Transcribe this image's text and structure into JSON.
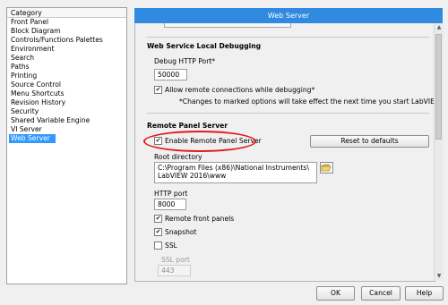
{
  "sidebar": {
    "header": "Category",
    "items": [
      {
        "label": "Front Panel",
        "selected": false
      },
      {
        "label": "Block Diagram",
        "selected": false
      },
      {
        "label": "Controls/Functions Palettes",
        "selected": false
      },
      {
        "label": "Environment",
        "selected": false
      },
      {
        "label": "Search",
        "selected": false
      },
      {
        "label": "Paths",
        "selected": false
      },
      {
        "label": "Printing",
        "selected": false
      },
      {
        "label": "Source Control",
        "selected": false
      },
      {
        "label": "Menu Shortcuts",
        "selected": false
      },
      {
        "label": "Revision History",
        "selected": false
      },
      {
        "label": "Security",
        "selected": false
      },
      {
        "label": "Shared Variable Engine",
        "selected": false
      },
      {
        "label": "VI Server",
        "selected": false
      },
      {
        "label": "Web Server",
        "selected": true
      }
    ]
  },
  "panel": {
    "title": "Web Server",
    "debugging": {
      "section_title": "Web Service Local Debugging",
      "port_label": "Debug HTTP Port*",
      "port_value": "50000",
      "allow_remote_label": "Allow remote connections while debugging*",
      "allow_remote_checked": true,
      "note": "*Changes to marked options will take effect the next time you start LabVIEW."
    },
    "remote_panel": {
      "section_title": "Remote Panel Server",
      "enable_label": "Enable Remote Panel Server",
      "enable_checked": true,
      "reset_button": "Reset to defaults",
      "root_dir_label": "Root directory",
      "root_dir_line1": "C:\\Program Files (x86)\\National Instruments\\",
      "root_dir_line2": "LabVIEW 2016\\www",
      "http_port_label": "HTTP port",
      "http_port_value": "8000",
      "remote_front_panels_label": "Remote front panels",
      "remote_front_panels_checked": true,
      "snapshot_label": "Snapshot",
      "snapshot_checked": true,
      "ssl_label": "SSL",
      "ssl_checked": false,
      "ssl_port_label": "SSL port",
      "ssl_port_value": "443"
    }
  },
  "footer": {
    "ok": "OK",
    "cancel": "Cancel",
    "help": "Help"
  },
  "colors": {
    "title_bar": "#2f8ae0",
    "selection": "#3399ff",
    "highlight_ellipse": "#e01b1b"
  }
}
